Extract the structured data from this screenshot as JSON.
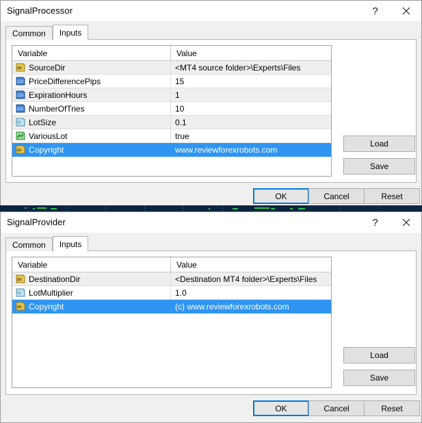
{
  "windows": [
    {
      "title": "SignalProcessor",
      "titlebar_buttons": [
        {
          "name": "help",
          "glyph": "?"
        },
        {
          "name": "close",
          "glyph": "✕"
        }
      ],
      "tabs": [
        {
          "label": "Common",
          "active": false
        },
        {
          "label": "Inputs",
          "active": true
        }
      ],
      "grid": {
        "columns": [
          "Variable",
          "Value"
        ],
        "rows": [
          {
            "icon": "string-type-icon",
            "variable": "SourceDir",
            "value": "<MT4 source folder>\\Experts\\Files",
            "alt": true,
            "selected": false
          },
          {
            "icon": "integer-type-icon",
            "variable": "PriceDifferencePips",
            "value": "15",
            "alt": false,
            "selected": false
          },
          {
            "icon": "integer-type-icon",
            "variable": "ExpirationHours",
            "value": "1",
            "alt": true,
            "selected": false
          },
          {
            "icon": "integer-type-icon",
            "variable": "NumberOfTries",
            "value": "10",
            "alt": false,
            "selected": false
          },
          {
            "icon": "double-type-icon",
            "variable": "LotSize",
            "value": "0.1",
            "alt": true,
            "selected": false
          },
          {
            "icon": "bool-type-icon",
            "variable": "VariousLot",
            "value": "true",
            "alt": false,
            "selected": false
          },
          {
            "icon": "string-type-icon",
            "variable": "Copyright",
            "value": "www.reviewforexrobots.com",
            "alt": false,
            "selected": true
          }
        ]
      },
      "side_buttons": [
        {
          "label": "Load"
        },
        {
          "label": "Save"
        }
      ],
      "bottom_buttons": [
        {
          "label": "OK",
          "default": true
        },
        {
          "label": "Cancel",
          "default": false
        },
        {
          "label": "Reset",
          "default": false
        }
      ]
    },
    {
      "title": "SignalProvider",
      "titlebar_buttons": [
        {
          "name": "help",
          "glyph": "?"
        },
        {
          "name": "close",
          "glyph": "✕"
        }
      ],
      "tabs": [
        {
          "label": "Common",
          "active": false
        },
        {
          "label": "Inputs",
          "active": true
        }
      ],
      "grid": {
        "columns": [
          "Variable",
          "Value"
        ],
        "rows": [
          {
            "icon": "string-type-icon",
            "variable": "DestinationDir",
            "value": "<Destination MT4 folder>\\Experts\\Files",
            "alt": true,
            "selected": false
          },
          {
            "icon": "double-type-icon",
            "variable": "LotMultiplier",
            "value": "1.0",
            "alt": false,
            "selected": false
          },
          {
            "icon": "string-type-icon",
            "variable": "Copyright",
            "value": "(c) www.reviewforexrobots.com",
            "alt": true,
            "selected": true
          }
        ]
      },
      "side_buttons": [
        {
          "label": "Load"
        },
        {
          "label": "Save"
        }
      ],
      "bottom_buttons": [
        {
          "label": "OK",
          "default": true
        },
        {
          "label": "Cancel",
          "default": false
        },
        {
          "label": "Reset",
          "default": false
        }
      ]
    }
  ],
  "colors": {
    "selection": "#2f95f2",
    "default_button_border": "#0078d7",
    "window_background": "#f0f0f0",
    "grid_background": "#ffffff",
    "alt_row": "#efefef"
  }
}
